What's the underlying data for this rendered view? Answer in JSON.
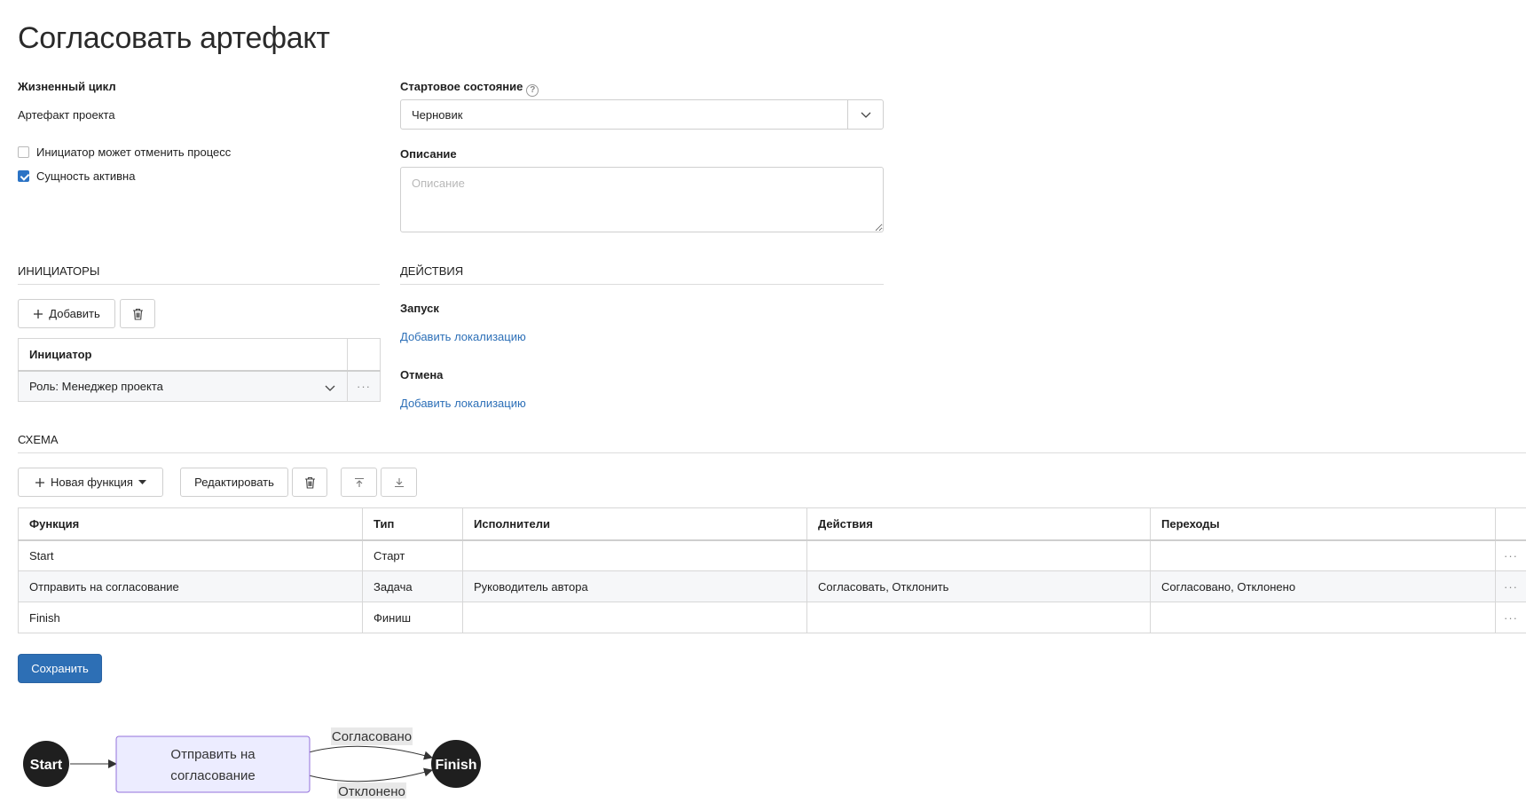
{
  "page": {
    "title": "Согласовать артефакт"
  },
  "lifecycle": {
    "label": "Жизненный цикл",
    "value": "Артефакт проекта"
  },
  "options": {
    "initiator_can_cancel": {
      "label": "Инициатор может отменить процесс",
      "checked": false
    },
    "entity_active": {
      "label": "Сущность активна",
      "checked": true
    }
  },
  "start_state": {
    "label": "Стартовое состояние",
    "value": "Черновик"
  },
  "description": {
    "label": "Описание",
    "placeholder": "Описание",
    "value": ""
  },
  "initiators": {
    "header": "ИНИЦИАТОРЫ",
    "add_label": "Добавить",
    "column": "Инициатор",
    "rows": [
      {
        "value": "Роль: Менеджер проекта"
      }
    ]
  },
  "actions": {
    "header": "ДЕЙСТВИЯ",
    "launch": {
      "label": "Запуск",
      "link": "Добавить локализацию"
    },
    "cancel": {
      "label": "Отмена",
      "link": "Добавить локализацию"
    }
  },
  "schema": {
    "header": "СХЕМА",
    "new_function_label": "Новая функция",
    "edit_label": "Редактировать",
    "columns": [
      "Функция",
      "Тип",
      "Исполнители",
      "Действия",
      "Переходы"
    ],
    "rows": [
      {
        "function": "Start",
        "type": "Старт",
        "performers": "",
        "actions": "",
        "transitions": ""
      },
      {
        "function": "Отправить на согласование",
        "type": "Задача",
        "performers": "Руководитель автора",
        "actions": "Согласовать, Отклонить",
        "transitions": "Согласовано, Отклонено"
      },
      {
        "function": "Finish",
        "type": "Финиш",
        "performers": "",
        "actions": "",
        "transitions": ""
      }
    ]
  },
  "save_label": "Сохранить",
  "diagram": {
    "start": "Start",
    "task_line1": "Отправить на",
    "task_line2": "согласование",
    "finish": "Finish",
    "edge_approved": "Согласовано",
    "edge_rejected": "Отклонено"
  },
  "colors": {
    "accent": "#2d6fb5",
    "link": "#2c6fb7",
    "task_fill": "#ececff",
    "task_stroke": "#9370db",
    "node_dark": "#1f1f1f"
  }
}
